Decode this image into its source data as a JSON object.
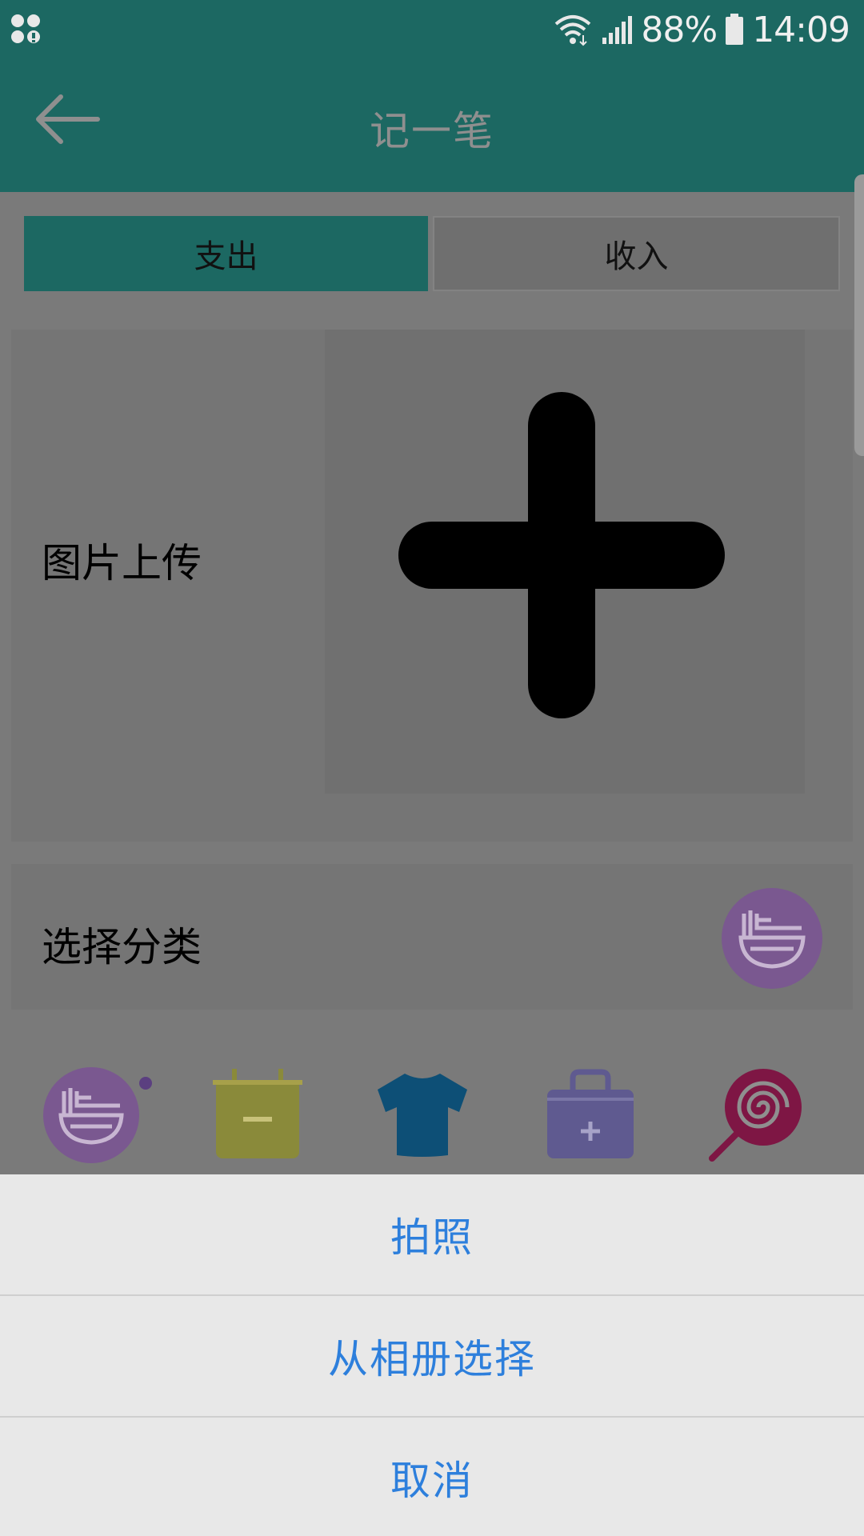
{
  "status_bar": {
    "battery": "88%",
    "time": "14:09",
    "icons": [
      "notification-apps-icon",
      "wifi-icon",
      "signal-icon",
      "battery-icon"
    ]
  },
  "toolbar": {
    "title": "记一笔",
    "back_icon": "arrow-left-icon"
  },
  "tabs": [
    {
      "label": "支出",
      "selected": true
    },
    {
      "label": "收入",
      "selected": false
    }
  ],
  "upload": {
    "label": "图片上传",
    "icon": "plus-icon"
  },
  "category": {
    "label": "选择分类",
    "current_icon": "food-bowl-icon"
  },
  "category_icons": [
    {
      "name": "food-bowl-icon",
      "color": "#7a5890",
      "selected": true
    },
    {
      "name": "calendar-icon",
      "color": "#8a8a3a"
    },
    {
      "name": "tshirt-icon",
      "color": "#0d4f76"
    },
    {
      "name": "medical-kit-icon",
      "color": "#5f5a90"
    },
    {
      "name": "lollipop-icon",
      "color": "#7e1644"
    }
  ],
  "action_sheet": {
    "items": [
      {
        "label": "拍照"
      },
      {
        "label": "从相册选择"
      },
      {
        "label": "取消"
      }
    ],
    "text_color": "#2d7fdc"
  },
  "colors": {
    "primary": "#1c6862",
    "overlay_bg": "#7a7a7a",
    "sheet_bg": "#e8e8e8"
  }
}
